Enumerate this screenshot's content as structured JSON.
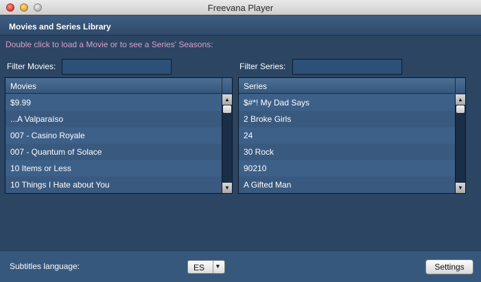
{
  "window": {
    "title": "Freevana Player"
  },
  "header": {
    "title": "Movies and Series Library"
  },
  "instruction": "Double click to load a Movie or to see a Series' Seasons:",
  "filters": {
    "movies_label": "Filter Movies:",
    "movies_value": "",
    "series_label": "Filter Series:",
    "series_value": ""
  },
  "movies_table": {
    "header": "Movies",
    "rows": [
      "$9.99",
      "...A Valparaíso",
      "007 - Casino Royale",
      "007 - Quantum of Solace",
      "10 Items or Less",
      "10 Things I Hate about You"
    ]
  },
  "series_table": {
    "header": "Series",
    "rows": [
      "$#*! My Dad Says",
      "2 Broke Girls",
      "24",
      "30 Rock",
      "90210",
      "A Gifted Man"
    ]
  },
  "footer": {
    "subtitles_label": "Subtitles language:",
    "subtitles_value": "ES",
    "settings_label": "Settings"
  },
  "icons": {
    "scroll_up": "up-arrow",
    "scroll_down": "down-arrow",
    "dropdown": "chevron-down"
  },
  "colors": {
    "window_bg": "#2b4563",
    "instruction_text": "#d9a0c8",
    "row_bg": "#3d6089"
  }
}
